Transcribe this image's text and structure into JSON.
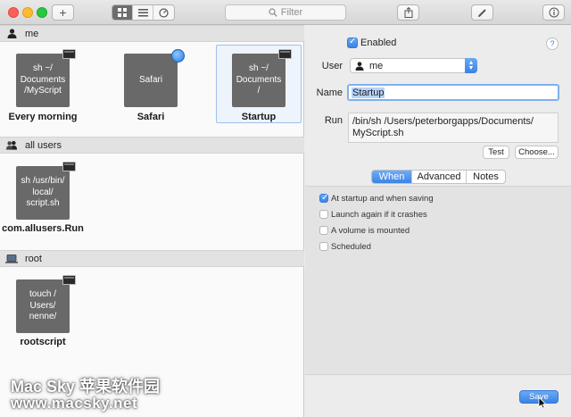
{
  "toolbar": {
    "add_label": "+",
    "search_placeholder": "Filter",
    "view_modes": [
      "grid",
      "list",
      "gauge"
    ]
  },
  "sections": [
    {
      "title": "me",
      "icon": "person-icon",
      "items": [
        {
          "tile_text": "sh ~/\nDocuments\n/MyScript",
          "label": "Every morning",
          "badge": "terminal-icon",
          "selected": false
        },
        {
          "tile_text": "Safari",
          "label": "Safari",
          "badge": "safari-compass-icon",
          "selected": false
        },
        {
          "tile_text": "sh ~/\nDocuments\n/",
          "label": "Startup",
          "badge": "terminal-icon",
          "selected": true
        }
      ]
    },
    {
      "title": "all users",
      "icon": "group-icon",
      "items": [
        {
          "tile_text": "sh /usr/bin/\nlocal/\nscript.sh",
          "label": "com.allusers.Run",
          "badge": "terminal-icon",
          "selected": false
        }
      ]
    },
    {
      "title": "root",
      "icon": "laptop-icon",
      "items": [
        {
          "tile_text": "touch /\nUsers/\nnenne/",
          "label": "rootscript",
          "badge": "terminal-icon",
          "selected": false
        }
      ]
    }
  ],
  "detail": {
    "enabled_label": "Enabled",
    "enabled": true,
    "help_label": "?",
    "user_label": "User",
    "user_value": "me",
    "name_label": "Name",
    "name_value": "Startup",
    "run_label": "Run",
    "run_value": "/bin/sh /Users/peterborgapps/Documents/\nMyScript.sh",
    "test_button": "Test",
    "choose_button": "Choose...",
    "tabs": [
      "When",
      "Advanced",
      "Notes"
    ],
    "active_tab": "When",
    "options": [
      {
        "label": "At startup and when saving",
        "checked": true
      },
      {
        "label": "Launch again if it crashes",
        "checked": false
      },
      {
        "label": "A volume is mounted",
        "checked": false
      },
      {
        "label": "Scheduled",
        "checked": false
      }
    ],
    "save_button": "Save"
  },
  "watermark": {
    "line1": "Mac Sky 苹果软件园",
    "line2": "www.macsky.net"
  },
  "colors": {
    "accent": "#3a83e6",
    "tile": "#696969",
    "selection_border": "#9fc0e8",
    "close": "#fc5f57",
    "minimize": "#fdbc2e",
    "zoom": "#28c840"
  }
}
